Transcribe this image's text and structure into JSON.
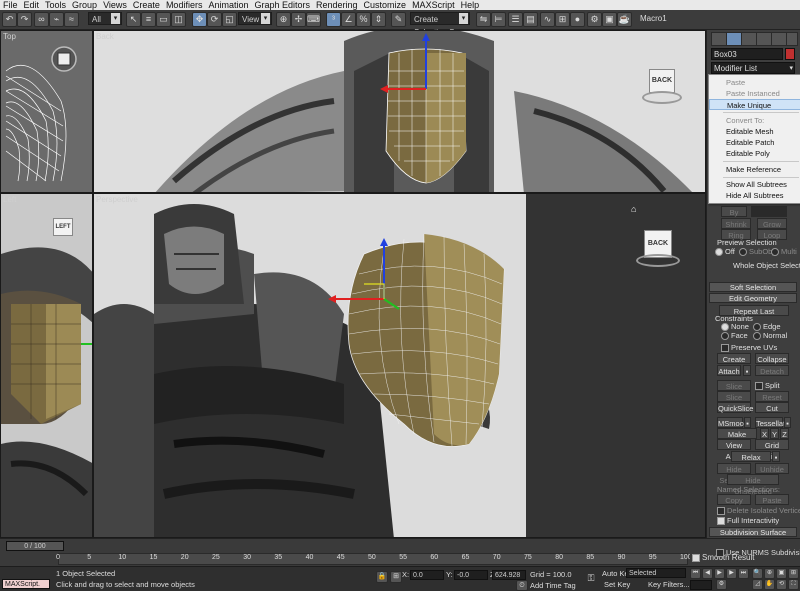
{
  "menu": [
    "File",
    "Edit",
    "Tools",
    "Group",
    "Views",
    "Create",
    "Modifiers",
    "Animation",
    "Graph Editors",
    "Rendering",
    "Customize",
    "MAXScript",
    "Help"
  ],
  "toolbar": {
    "selection_filter": "All",
    "reference_coord": "View",
    "named_selection": "Create Selection Se",
    "macro": "Macro1"
  },
  "viewports": {
    "top": {
      "label": "Top"
    },
    "back": {
      "label": "Back",
      "cube_label": "BACK"
    },
    "left": {
      "label": "Left",
      "cube_label": "LEFT"
    },
    "perspective": {
      "label": "Perspective",
      "cube_label": "BACK"
    }
  },
  "command_panel": {
    "object_name": "Box03",
    "modifier_list": "Modifier List",
    "preview_selection_label": "Preview Selection",
    "preview_off": "Off",
    "preview_subobj": "SubObj",
    "preview_multi": "Multi",
    "whole_object_selected": "Whole Object Selected",
    "soft_selection": "Soft Selection",
    "edit_geometry": "Edit Geometry",
    "repeat_last": "Repeat Last",
    "constraints": "Constraints",
    "c_none": "None",
    "c_edge": "Edge",
    "c_face": "Face",
    "c_normal": "Normal",
    "preserve_uvs": "Preserve UVs",
    "create": "Create",
    "collapse": "Collapse",
    "attach": "Attach",
    "detach": "Detach",
    "slice_plane": "Slice Plane",
    "split": "Split",
    "slice": "Slice",
    "reset_plane": "Reset Plane",
    "quickslice": "QuickSlice",
    "cut": "Cut",
    "msmooth": "MSmooth",
    "tessellate": "Tessellate",
    "make_planar": "Make Planar",
    "x": "X",
    "y": "Y",
    "z": "Z",
    "view_align": "View Align",
    "grid_align": "Grid Align",
    "relax": "Relax",
    "hide_selected": "Hide Selected",
    "unhide_all": "Unhide All",
    "hide_unselected": "Hide Unselected",
    "named_selections": "Named Selections:",
    "copy": "Copy",
    "paste": "Paste",
    "delete_isolated": "Delete Isolated Vertices",
    "full_interactivity": "Full Interactivity",
    "subdivision_surface": "Subdivision Surface",
    "smooth_result": "Smooth Result",
    "use_nurms": "Use NURMS Subdivision"
  },
  "context_menu": [
    {
      "label": "Paste",
      "enabled": false
    },
    {
      "label": "Paste Instanced",
      "enabled": false
    },
    {
      "label": "Make Unique",
      "enabled": true,
      "highlighted": true
    },
    {
      "separator": true
    },
    {
      "label": "Convert To:",
      "enabled": false
    },
    {
      "label": "Editable Mesh",
      "enabled": true
    },
    {
      "label": "Editable Patch",
      "enabled": true
    },
    {
      "label": "Editable Poly",
      "enabled": true
    },
    {
      "separator": true
    },
    {
      "label": "Make Reference",
      "enabled": true
    },
    {
      "separator": true
    },
    {
      "label": "Show All Subtrees",
      "enabled": true
    },
    {
      "label": "Hide All Subtrees",
      "enabled": true
    }
  ],
  "timeline": {
    "frame_indicator": "0 / 100",
    "ticks": [
      "0",
      "5",
      "10",
      "15",
      "20",
      "25",
      "30",
      "35",
      "40",
      "45",
      "50",
      "55",
      "60",
      "65",
      "70",
      "75",
      "80",
      "85",
      "90",
      "95",
      "100"
    ]
  },
  "status": {
    "maxscript": "MAXScript.",
    "selection": "1 Object Selected",
    "prompt": "Click and drag to select and move objects",
    "x_label": "X:",
    "x_value": "0.0",
    "y_label": "Y:",
    "y_value": "-0.0",
    "z_label": "Z:",
    "z_value": "624.928",
    "grid": "Grid = 100.0",
    "add_time_tag": "Add Time Tag",
    "auto_key": "Auto Key",
    "auto_key_value": "Selected",
    "set_key": "Set Key",
    "key_filters": "Key Filters..."
  },
  "colors": {
    "ui_dark": "#3e3e3e",
    "menubar": "#e9e9e9",
    "axis_x": "#e02020",
    "axis_y": "#20c020",
    "axis_z": "#2040e0",
    "mesh_face": "#7a6a40",
    "highlight": "#cfe3f7"
  }
}
